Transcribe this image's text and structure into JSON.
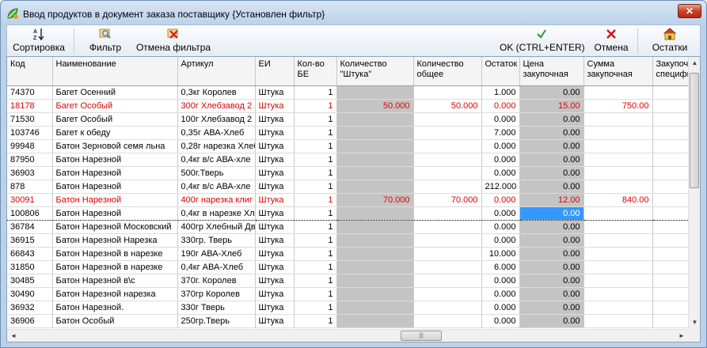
{
  "window": {
    "title": "Ввод продуктов в документ заказа поставщику {Установлен фильтр}",
    "close_symbol": "✕"
  },
  "toolbar": {
    "sort_label": "Сортировка",
    "filter_label": "Фильтр",
    "cancel_filter_label": "Отмена фильтра",
    "ok_label": "OK (CTRL+ENTER)",
    "cancel_label": "Отмена",
    "stock_label": "Остатки"
  },
  "columns": [
    "Код",
    "Наименование",
    "Артикул",
    "ЕИ",
    "Кол-во\nБЕ",
    "Количество\n\"Штука\"",
    "Количество\nобщее",
    "Остаток",
    "Цена\nзакупочная",
    "Сумма\nзакупочная",
    "Закупочная\nспецифика"
  ],
  "rows": [
    {
      "code": "74370",
      "name": "Багет Осенний",
      "art": "0,3кг Королев",
      "unit": "Штука",
      "qty_be": "1",
      "qty_pc": "",
      "qty_total": "",
      "rest": "1.000",
      "price": "0.00",
      "sum": "",
      "red": false
    },
    {
      "code": "18178",
      "name": "Багет Особый",
      "art": "300г Хлебзавод 2",
      "unit": "Штука",
      "qty_be": "1",
      "qty_pc": "50.000",
      "qty_total": "50.000",
      "rest": "0.000",
      "price": "15.00",
      "sum": "750.00",
      "red": true
    },
    {
      "code": "71530",
      "name": "Багет Особый",
      "art": "100г Хлебзавод 2",
      "unit": "Штука",
      "qty_be": "1",
      "qty_pc": "",
      "qty_total": "",
      "rest": "0.000",
      "price": "0.00",
      "sum": "",
      "red": false
    },
    {
      "code": "103746",
      "name": "Багет к обеду",
      "art": "0,35г АВА-Хлеб",
      "unit": "Штука",
      "qty_be": "1",
      "qty_pc": "",
      "qty_total": "",
      "rest": "7.000",
      "price": "0.00",
      "sum": "",
      "red": false
    },
    {
      "code": "99948",
      "name": "Батон Зерновой семя льна",
      "art": "0,28г нарезка Хлеб",
      "unit": "Штука",
      "qty_be": "1",
      "qty_pc": "",
      "qty_total": "",
      "rest": "0.000",
      "price": "0.00",
      "sum": "",
      "red": false
    },
    {
      "code": "87950",
      "name": "Батон Нарезной",
      "art": "0,4кг в/с АВА-хле",
      "unit": "Штука",
      "qty_be": "1",
      "qty_pc": "",
      "qty_total": "",
      "rest": "0.000",
      "price": "0.00",
      "sum": "",
      "red": false
    },
    {
      "code": "36903",
      "name": "Батон Нарезной",
      "art": "500г.Тверь",
      "unit": "Штука",
      "qty_be": "1",
      "qty_pc": "",
      "qty_total": "",
      "rest": "0.000",
      "price": "0.00",
      "sum": "",
      "red": false
    },
    {
      "code": "878",
      "name": "Батон Нарезной",
      "art": "0,4кг в/с АВА-хле",
      "unit": "Штука",
      "qty_be": "1",
      "qty_pc": "",
      "qty_total": "",
      "rest": "212.000",
      "price": "0.00",
      "sum": "",
      "red": false
    },
    {
      "code": "30091",
      "name": "Батон Нарезной",
      "art": "400г нарезка клиг",
      "unit": "Штука",
      "qty_be": "1",
      "qty_pc": "70.000",
      "qty_total": "70.000",
      "rest": "0.000",
      "price": "12.00",
      "sum": "840.00",
      "red": true
    },
    {
      "code": "100806",
      "name": "Батон Нарезной",
      "art": "0,4кг в нарезке Хл",
      "unit": "Штука",
      "qty_be": "1",
      "qty_pc": "",
      "qty_total": "",
      "rest": "0.000",
      "price": "0.00",
      "sum": "",
      "red": false,
      "current": true
    },
    {
      "code": "36784",
      "name": "Батон Нарезной Московский",
      "art": "400гр Хлебный Дв",
      "unit": "Штука",
      "qty_be": "1",
      "qty_pc": "",
      "qty_total": "",
      "rest": "0.000",
      "price": "0.00",
      "sum": "",
      "red": false
    },
    {
      "code": "36915",
      "name": "Батон Нарезной Нарезка",
      "art": "330гр. Тверь",
      "unit": "Штука",
      "qty_be": "1",
      "qty_pc": "",
      "qty_total": "",
      "rest": "0.000",
      "price": "0.00",
      "sum": "",
      "red": false
    },
    {
      "code": "66843",
      "name": "Батон Нарезной в нарезке",
      "art": "190г АВА-Хлеб",
      "unit": "Штука",
      "qty_be": "1",
      "qty_pc": "",
      "qty_total": "",
      "rest": "10.000",
      "price": "0.00",
      "sum": "",
      "red": false
    },
    {
      "code": "31850",
      "name": "Батон Нарезной в нарезке",
      "art": "0,4кг АВА-Хлеб",
      "unit": "Штука",
      "qty_be": "1",
      "qty_pc": "",
      "qty_total": "",
      "rest": "6.000",
      "price": "0.00",
      "sum": "",
      "red": false
    },
    {
      "code": "30485",
      "name": "Батон Нарезной в\\с",
      "art": "370г. Королев",
      "unit": "Штука",
      "qty_be": "1",
      "qty_pc": "",
      "qty_total": "",
      "rest": "0.000",
      "price": "0.00",
      "sum": "",
      "red": false
    },
    {
      "code": "30490",
      "name": "Батон Нарезной нарезка",
      "art": "370гр Королев",
      "unit": "Штука",
      "qty_be": "1",
      "qty_pc": "",
      "qty_total": "",
      "rest": "0.000",
      "price": "0.00",
      "sum": "",
      "red": false
    },
    {
      "code": "36932",
      "name": "Батон Нарезной.",
      "art": "330г Тверь",
      "unit": "Штука",
      "qty_be": "1",
      "qty_pc": "",
      "qty_total": "",
      "rest": "0.000",
      "price": "0.00",
      "sum": "",
      "red": false
    },
    {
      "code": "36906",
      "name": "Батон Особый",
      "art": "250гр.Тверь",
      "unit": "Штука",
      "qty_be": "1",
      "qty_pc": "",
      "qty_total": "",
      "rest": "0.000",
      "price": "0.00",
      "sum": "",
      "red": false
    }
  ],
  "icons": {
    "app": "app-leaf-icon",
    "sort": "sort-az-icon",
    "filter": "magnifier-filter-icon",
    "cancel_filter": "filter-remove-icon",
    "ok": "green-check-icon",
    "cancel": "red-x-icon",
    "stock": "warehouse-icon"
  },
  "scrollbar": {
    "h_thumb_grip": "|||",
    "up": "▲",
    "down": "▼",
    "left": "◄",
    "right": "►"
  },
  "colors": {
    "highlight_row_text": "#e00000",
    "selected_cell": "#3399ff",
    "readonly_cell": "#c4c4c4"
  }
}
